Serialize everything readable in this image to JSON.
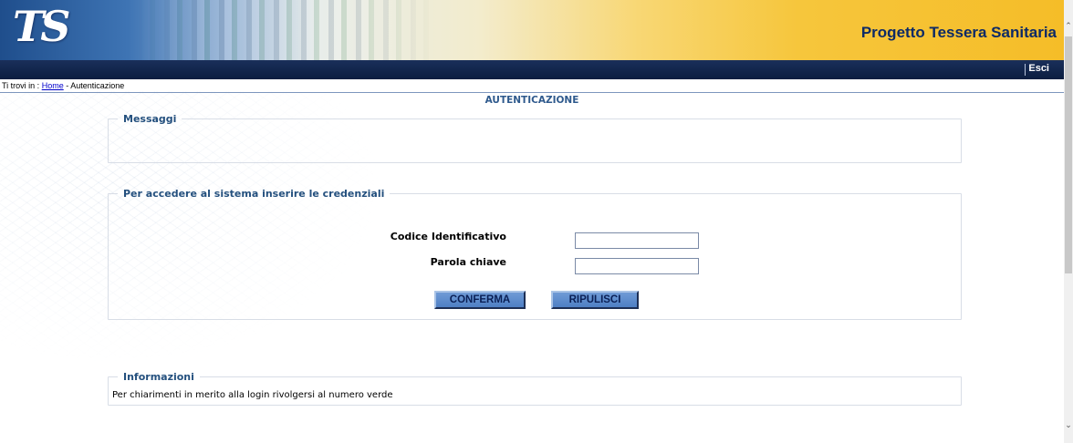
{
  "header": {
    "logo_text": "TS",
    "title": "Progetto Tessera Sanitaria",
    "exit_label": "Esci"
  },
  "breadcrumb": {
    "prefix": "Ti trovi in :",
    "home": "Home",
    "separator": "-",
    "current": "Autenticazione"
  },
  "page_title": "AUTENTICAZIONE",
  "messages": {
    "legend": "Messaggi"
  },
  "login": {
    "legend": "Per accedere al sistema inserire le credenziali",
    "id_label": "Codice Identificativo",
    "id_value": "",
    "password_label": "Parola chiave",
    "password_value": "",
    "confirm_label": "CONFERMA",
    "reset_label": "RIPULISCI"
  },
  "info": {
    "legend": "Informazioni",
    "text": "Per chiarimenti in merito alla login rivolgersi al numero verde"
  },
  "colors": {
    "navbar": "#0b1e40",
    "accent_yellow": "#f5bd28",
    "title_blue": "#0d2a66",
    "button_blue": "#5a89cc",
    "legend_blue": "#24507e"
  },
  "icons": {
    "scroll_up": "chevron-up-icon",
    "scroll_down": "chevron-down-icon"
  }
}
